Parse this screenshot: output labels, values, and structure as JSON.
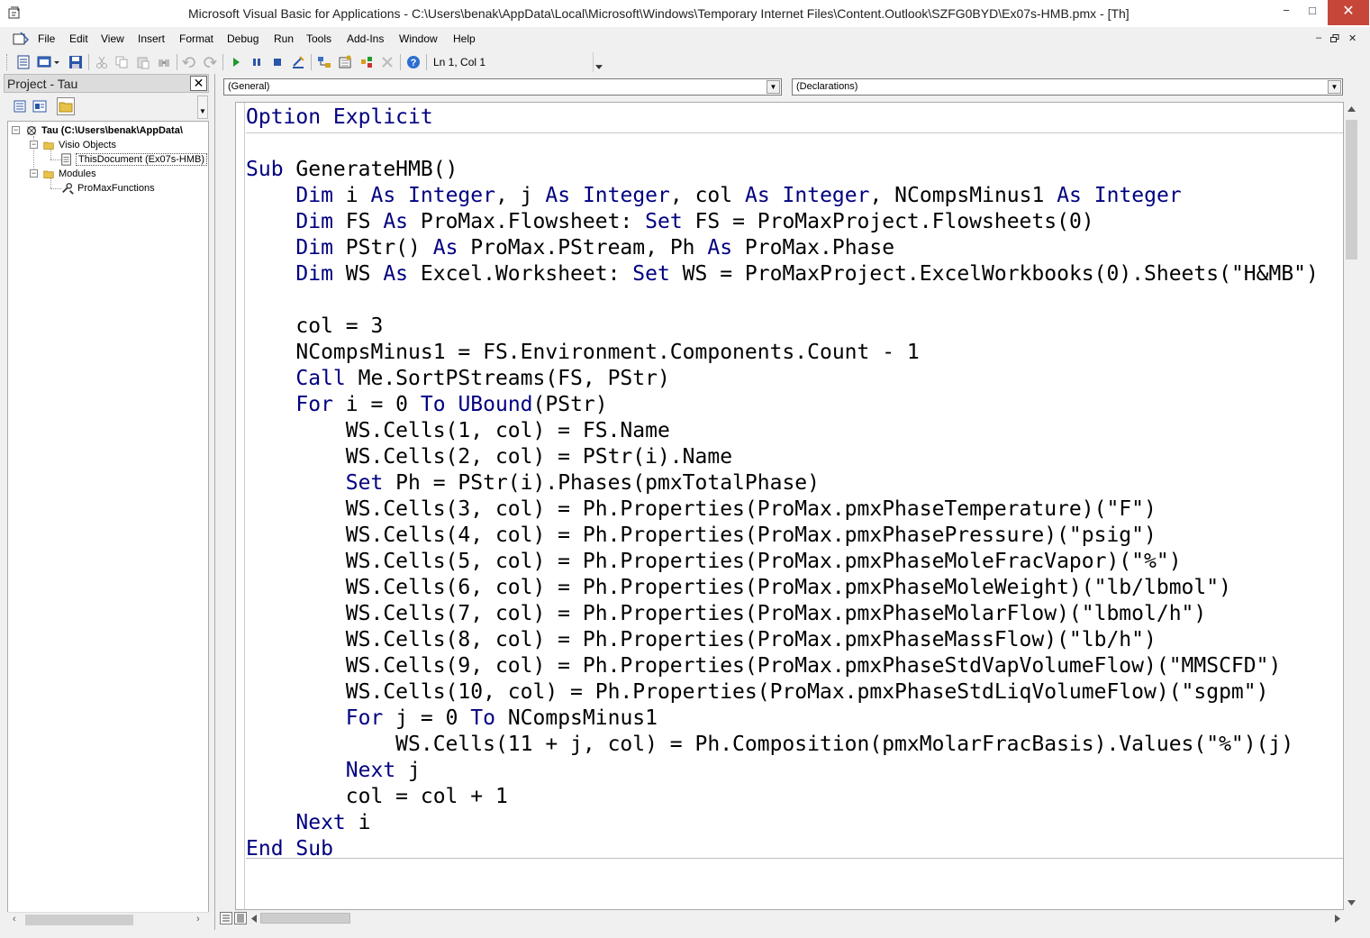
{
  "window": {
    "title": "Microsoft Visual Basic for Applications - C:\\Users\\benak\\AppData\\Local\\Microsoft\\Windows\\Temporary Internet Files\\Content.Outlook\\SZFG0BYD\\Ex07s-HMB.pmx - [Th]",
    "minimize": "−",
    "maximize": "□",
    "close": "✕"
  },
  "menu": {
    "items": [
      "File",
      "Edit",
      "View",
      "Insert",
      "Format",
      "Debug",
      "Run",
      "Tools",
      "Add-Ins",
      "Window",
      "Help"
    ],
    "mdi_minimize": "–",
    "mdi_restore": "2",
    "mdi_close": "✕"
  },
  "toolbar": {
    "status": "Ln 1, Col 1",
    "icons": [
      "view-excel-icon",
      "insert-module-icon",
      "save-icon",
      "cut-icon",
      "copy-icon",
      "paste-icon",
      "find-icon",
      "undo-icon",
      "redo-icon",
      "run-icon",
      "break-icon",
      "reset-icon",
      "design-mode-icon",
      "project-explorer-icon",
      "properties-icon",
      "object-browser-icon",
      "toolbox-icon",
      "help-icon"
    ]
  },
  "project": {
    "title": "Project - Tau",
    "close": "✕",
    "tree": {
      "root": "Tau (C:\\Users\\benak\\AppData\\",
      "folder1": "Visio Objects",
      "doc": "ThisDocument (Ex07s-HMB)",
      "folder2": "Modules",
      "module": "ProMaxFunctions"
    },
    "expanders": {
      "root": "−",
      "folder1": "−",
      "folder2": "−"
    }
  },
  "code": {
    "object_combo": "(General)",
    "proc_combo": "(Declarations)",
    "declarations": [
      [
        {
          "t": "Option Explicit",
          "k": true
        }
      ]
    ],
    "lines": [
      [
        {
          "t": "Sub",
          "k": true
        },
        {
          "t": " GenerateHMB()",
          "k": false
        }
      ],
      [
        {
          "t": "    ",
          "k": false
        },
        {
          "t": "Dim",
          "k": true
        },
        {
          "t": " i ",
          "k": false
        },
        {
          "t": "As",
          "k": true
        },
        {
          "t": " ",
          "k": false
        },
        {
          "t": "Integer",
          "k": true
        },
        {
          "t": ", j ",
          "k": false
        },
        {
          "t": "As",
          "k": true
        },
        {
          "t": " ",
          "k": false
        },
        {
          "t": "Integer",
          "k": true
        },
        {
          "t": ", col ",
          "k": false
        },
        {
          "t": "As",
          "k": true
        },
        {
          "t": " ",
          "k": false
        },
        {
          "t": "Integer",
          "k": true
        },
        {
          "t": ", NCompsMinus1 ",
          "k": false
        },
        {
          "t": "As",
          "k": true
        },
        {
          "t": " ",
          "k": false
        },
        {
          "t": "Integer",
          "k": true
        }
      ],
      [
        {
          "t": "    ",
          "k": false
        },
        {
          "t": "Dim",
          "k": true
        },
        {
          "t": " FS ",
          "k": false
        },
        {
          "t": "As",
          "k": true
        },
        {
          "t": " ProMax.Flowsheet: ",
          "k": false
        },
        {
          "t": "Set",
          "k": true
        },
        {
          "t": " FS = ProMaxProject.Flowsheets(0)",
          "k": false
        }
      ],
      [
        {
          "t": "    ",
          "k": false
        },
        {
          "t": "Dim",
          "k": true
        },
        {
          "t": " PStr() ",
          "k": false
        },
        {
          "t": "As",
          "k": true
        },
        {
          "t": " ProMax.PStream, Ph ",
          "k": false
        },
        {
          "t": "As",
          "k": true
        },
        {
          "t": " ProMax.Phase",
          "k": false
        }
      ],
      [
        {
          "t": "    ",
          "k": false
        },
        {
          "t": "Dim",
          "k": true
        },
        {
          "t": " WS ",
          "k": false
        },
        {
          "t": "As",
          "k": true
        },
        {
          "t": " Excel.Worksheet: ",
          "k": false
        },
        {
          "t": "Set",
          "k": true
        },
        {
          "t": " WS = ProMaxProject.ExcelWorkbooks(0).Sheets(\"H&MB\")",
          "k": false
        }
      ],
      [
        {
          "t": "",
          "k": false
        }
      ],
      [
        {
          "t": "    col = 3",
          "k": false
        }
      ],
      [
        {
          "t": "    NCompsMinus1 = FS.Environment.Components.Count - 1",
          "k": false
        }
      ],
      [
        {
          "t": "    ",
          "k": false
        },
        {
          "t": "Call",
          "k": true
        },
        {
          "t": " Me.SortPStreams(FS, PStr)",
          "k": false
        }
      ],
      [
        {
          "t": "    ",
          "k": false
        },
        {
          "t": "For",
          "k": true
        },
        {
          "t": " i = 0 ",
          "k": false
        },
        {
          "t": "To",
          "k": true
        },
        {
          "t": " ",
          "k": false
        },
        {
          "t": "UBound",
          "k": true
        },
        {
          "t": "(PStr)",
          "k": false
        }
      ],
      [
        {
          "t": "        WS.Cells(1, col) = FS.Name",
          "k": false
        }
      ],
      [
        {
          "t": "        WS.Cells(2, col) = PStr(i).Name",
          "k": false
        }
      ],
      [
        {
          "t": "        ",
          "k": false
        },
        {
          "t": "Set",
          "k": true
        },
        {
          "t": " Ph = PStr(i).Phases(pmxTotalPhase)",
          "k": false
        }
      ],
      [
        {
          "t": "        WS.Cells(3, col) = Ph.Properties(ProMax.pmxPhaseTemperature)(\"F\")",
          "k": false
        }
      ],
      [
        {
          "t": "        WS.Cells(4, col) = Ph.Properties(ProMax.pmxPhasePressure)(\"psig\")",
          "k": false
        }
      ],
      [
        {
          "t": "        WS.Cells(5, col) = Ph.Properties(ProMax.pmxPhaseMoleFracVapor)(\"%\")",
          "k": false
        }
      ],
      [
        {
          "t": "        WS.Cells(6, col) = Ph.Properties(ProMax.pmxPhaseMoleWeight)(\"lb/lbmol\")",
          "k": false
        }
      ],
      [
        {
          "t": "        WS.Cells(7, col) = Ph.Properties(ProMax.pmxPhaseMolarFlow)(\"lbmol/h\")",
          "k": false
        }
      ],
      [
        {
          "t": "        WS.Cells(8, col) = Ph.Properties(ProMax.pmxPhaseMassFlow)(\"lb/h\")",
          "k": false
        }
      ],
      [
        {
          "t": "        WS.Cells(9, col) = Ph.Properties(ProMax.pmxPhaseStdVapVolumeFlow)(\"MMSCFD\")",
          "k": false
        }
      ],
      [
        {
          "t": "        WS.Cells(10, col) = Ph.Properties(ProMax.pmxPhaseStdLiqVolumeFlow)(\"sgpm\")",
          "k": false
        }
      ],
      [
        {
          "t": "        ",
          "k": false
        },
        {
          "t": "For",
          "k": true
        },
        {
          "t": " j = 0 ",
          "k": false
        },
        {
          "t": "To",
          "k": true
        },
        {
          "t": " NCompsMinus1",
          "k": false
        }
      ],
      [
        {
          "t": "            WS.Cells(11 + j, col) = Ph.Composition(pmxMolarFracBasis).Values(\"%\")(j)",
          "k": false
        }
      ],
      [
        {
          "t": "        ",
          "k": false
        },
        {
          "t": "Next",
          "k": true
        },
        {
          "t": " j",
          "k": false
        }
      ],
      [
        {
          "t": "        col = col + 1",
          "k": false
        }
      ],
      [
        {
          "t": "    ",
          "k": false
        },
        {
          "t": "Next",
          "k": true
        },
        {
          "t": " i",
          "k": false
        }
      ],
      [
        {
          "t": "End Sub",
          "k": true
        }
      ]
    ]
  },
  "colors": {
    "keyword": "#000080",
    "text": "#000000",
    "close_button": "#c7463a"
  }
}
